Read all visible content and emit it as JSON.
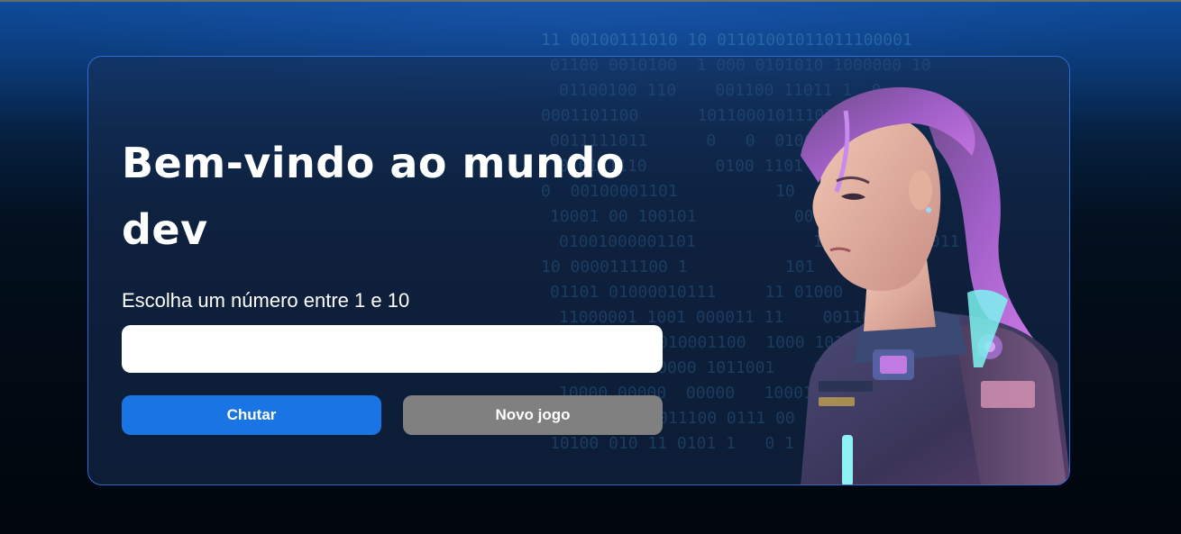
{
  "hero": {
    "title": "Bem-vindo ao mundo dev",
    "image_alt": "astronaut-woman-illustration"
  },
  "game": {
    "prompt": "Escolha um número entre 1 e 10",
    "input_value": "",
    "input_placeholder": ""
  },
  "buttons": {
    "guess_label": "Chutar",
    "new_game_label": "Novo jogo"
  },
  "background": {
    "binary_rows": [
      "11 00100111010 10 01101001011011100001",
      "01100 0010100  1 000 0101010 1000000 10",
      "01100100 110    001100 11011 1  0",
      "0001101100      10110001011101000010",
      "0011111011      0   0  0100000011  0 0",
      "010111110       0100 1101  1 0011011",
      "0  00100001101          10   0 1 10 0",
      "10001 00 100101          00 101 0101",
      "01001000001101            11 001 00100011",
      "10 0000111100 1          101   0",
      "01101 01000010111     11 01000",
      "11000001 1001 000011 11    00110",
      "11010000  10010001100  1000 1010",
      "1101000 1100000 1011001    011 11",
      "10000 00000  00000   1000110",
      "00 01111   1011100 0111 00",
      "10100 010 11 0101 1   0 1 0 0"
    ],
    "colors": {
      "accent": "#1b74e4",
      "secondary": "#808080",
      "card_border": "#2f6cd6"
    }
  }
}
